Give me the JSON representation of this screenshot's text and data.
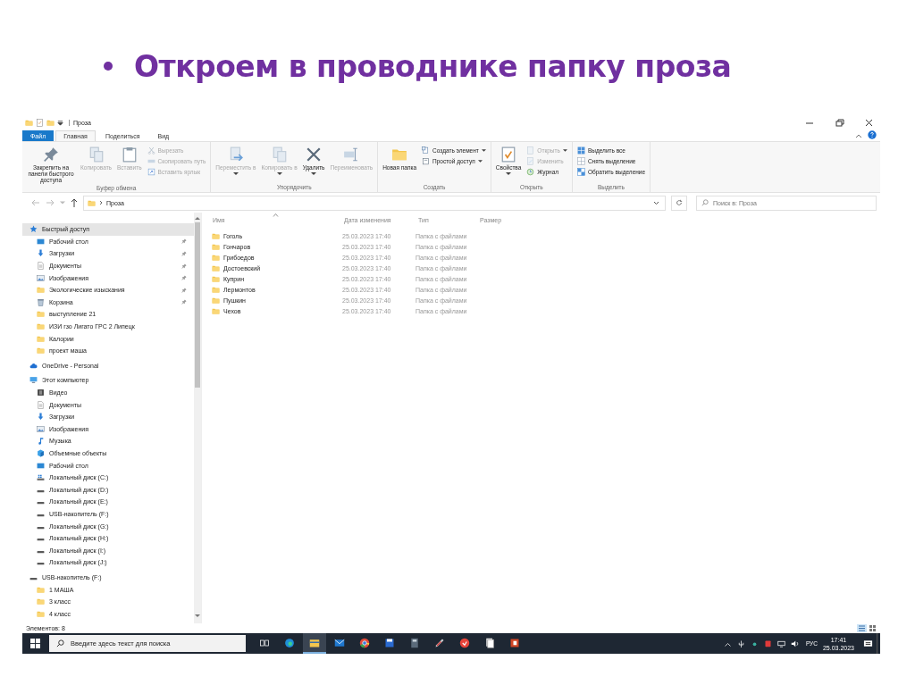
{
  "slide_title": "Откроем в проводнике папку проза",
  "window": {
    "title": "Проза"
  },
  "tabs": [
    {
      "label": "Файл",
      "kind": "file",
      "selected": false
    },
    {
      "label": "Главная",
      "kind": "tab",
      "selected": true
    },
    {
      "label": "Поделиться",
      "kind": "tab",
      "selected": false
    },
    {
      "label": "Вид",
      "kind": "tab",
      "selected": false
    }
  ],
  "ribbon": {
    "groups": [
      {
        "label": "Буфер обмена",
        "commands": [
          {
            "label": "Закрепить на панели быстрого доступа",
            "kind": "large",
            "disabled": false
          },
          {
            "label": "Копировать",
            "kind": "large",
            "disabled": true
          },
          {
            "label": "Вставить",
            "kind": "large",
            "disabled": true
          },
          {
            "label": "Вырезать",
            "kind": "small",
            "disabled": true
          },
          {
            "label": "Скопировать путь",
            "kind": "small",
            "disabled": true
          },
          {
            "label": "Вставить ярлык",
            "kind": "small",
            "disabled": true
          }
        ]
      },
      {
        "label": "Упорядочить",
        "commands": [
          {
            "label": "Переместить в",
            "kind": "large",
            "disabled": true,
            "dropdown": true
          },
          {
            "label": "Копировать в",
            "kind": "large",
            "disabled": true,
            "dropdown": true
          },
          {
            "label": "Удалить",
            "kind": "large",
            "disabled": false,
            "dropdown": true
          },
          {
            "label": "Переименовать",
            "kind": "large",
            "disabled": true
          }
        ]
      },
      {
        "label": "Создать",
        "commands": [
          {
            "label": "Новая папка",
            "kind": "large",
            "disabled": false
          },
          {
            "label": "Создать элемент",
            "kind": "small",
            "disabled": false,
            "dropdown": true
          },
          {
            "label": "Простой доступ",
            "kind": "small",
            "disabled": false,
            "dropdown": true
          }
        ]
      },
      {
        "label": "Открыть",
        "commands": [
          {
            "label": "Свойства",
            "kind": "large",
            "disabled": false,
            "dropdown": true
          },
          {
            "label": "Открыть",
            "kind": "small",
            "disabled": true,
            "dropdown": true
          },
          {
            "label": "Изменить",
            "kind": "small",
            "disabled": true
          },
          {
            "label": "Журнал",
            "kind": "small",
            "disabled": false
          }
        ]
      },
      {
        "label": "Выделить",
        "commands": [
          {
            "label": "Выделить все",
            "kind": "small",
            "disabled": false
          },
          {
            "label": "Снять выделение",
            "kind": "small",
            "disabled": false
          },
          {
            "label": "Обратить выделение",
            "kind": "small",
            "disabled": false
          }
        ]
      }
    ]
  },
  "address": {
    "path": "Проза",
    "search_placeholder": "Поиск в: Проза"
  },
  "sidebar": {
    "items": [
      {
        "label": "Быстрый доступ",
        "kind": "star",
        "selected": true,
        "children": [
          {
            "label": "Рабочий стол",
            "kind": "desktop",
            "selected": false,
            "pinned": true
          },
          {
            "label": "Загрузки",
            "kind": "download",
            "selected": false,
            "pinned": true
          },
          {
            "label": "Документы",
            "kind": "documents",
            "selected": false,
            "pinned": true
          },
          {
            "label": "Изображения",
            "kind": "pictures",
            "selected": false,
            "pinned": true
          },
          {
            "label": "Экологические изыскания",
            "kind": "folder",
            "selected": false,
            "pinned": true
          },
          {
            "label": "Корзина",
            "kind": "recycle",
            "selected": false,
            "pinned": true
          },
          {
            "label": "выступление 21",
            "kind": "folder",
            "selected": false,
            "pinned": false
          },
          {
            "label": "ИЗИ гзо Лигато ГРС 2 Липецк",
            "kind": "folder",
            "selected": false,
            "pinned": false
          },
          {
            "label": "Калории",
            "kind": "folder",
            "selected": false,
            "pinned": false
          },
          {
            "label": "проект маша",
            "kind": "folder",
            "selected": false,
            "pinned": false
          }
        ]
      },
      {
        "label": "OneDrive - Personal",
        "kind": "cloud",
        "selected": false
      },
      {
        "label": "Этот компьютер",
        "kind": "computer",
        "selected": false,
        "children": [
          {
            "label": "Видео",
            "kind": "video",
            "selected": false
          },
          {
            "label": "Документы",
            "kind": "documents",
            "selected": false
          },
          {
            "label": "Загрузки",
            "kind": "download",
            "selected": false
          },
          {
            "label": "Изображения",
            "kind": "pictures",
            "selected": false
          },
          {
            "label": "Музыка",
            "kind": "music",
            "selected": false
          },
          {
            "label": "Объемные объекты",
            "kind": "objects",
            "selected": false
          },
          {
            "label": "Рабочий стол",
            "kind": "desktop",
            "selected": false
          },
          {
            "label": "Локальный диск (C:)",
            "kind": "system-drive",
            "selected": false
          },
          {
            "label": "Локальный диск (D:)",
            "kind": "drive",
            "selected": false
          },
          {
            "label": "Локальный диск (E:)",
            "kind": "drive",
            "selected": false
          },
          {
            "label": "USB-накопитель (F:)",
            "kind": "drive",
            "selected": false
          },
          {
            "label": "Локальный диск (G:)",
            "kind": "drive",
            "selected": false
          },
          {
            "label": "Локальный диск (H:)",
            "kind": "drive",
            "selected": false
          },
          {
            "label": "Локальный диск (I:)",
            "kind": "drive",
            "selected": false
          },
          {
            "label": "Локальный диск (J:)",
            "kind": "drive",
            "selected": false
          }
        ]
      },
      {
        "label": "USB-накопитель (F:)",
        "kind": "drive",
        "selected": false,
        "children": [
          {
            "label": "1 МАША",
            "kind": "folder",
            "selected": false
          },
          {
            "label": "3 класс",
            "kind": "folder",
            "selected": false
          },
          {
            "label": "4 класс",
            "kind": "folder",
            "selected": false
          }
        ]
      }
    ]
  },
  "table": {
    "columns": [
      {
        "label": "Имя",
        "sorted": true
      },
      {
        "label": "Дата изменения",
        "sorted": false
      },
      {
        "label": "Тип",
        "sorted": false
      },
      {
        "label": "Размер",
        "sorted": false
      }
    ],
    "rows": [
      {
        "name": "Гоголь",
        "date": "25.03.2023 17:40",
        "type": "Папка с файлами"
      },
      {
        "name": "Гончаров",
        "date": "25.03.2023 17:40",
        "type": "Папка с файлами"
      },
      {
        "name": "Грибоедов",
        "date": "25.03.2023 17:40",
        "type": "Папка с файлами"
      },
      {
        "name": "Достоевский",
        "date": "25.03.2023 17:40",
        "type": "Папка с файлами"
      },
      {
        "name": "Куприн",
        "date": "25.03.2023 17:40",
        "type": "Папка с файлами"
      },
      {
        "name": "Лермонтов",
        "date": "25.03.2023 17:40",
        "type": "Папка с файлами"
      },
      {
        "name": "Пушкин",
        "date": "25.03.2023 17:40",
        "type": "Папка с файлами"
      },
      {
        "name": "Чехов",
        "date": "25.03.2023 17:40",
        "type": "Папка с файлами"
      }
    ]
  },
  "status_bar": {
    "text": "Элементов: 8"
  },
  "taskbar": {
    "search_placeholder": "Введите здесь текст для поиска",
    "apps": [
      {
        "kind": "task-view",
        "active": false
      },
      {
        "kind": "browser",
        "active": false
      },
      {
        "kind": "explorer",
        "active": true
      },
      {
        "kind": "mail",
        "active": false
      },
      {
        "kind": "chrome",
        "active": false
      },
      {
        "kind": "floppy",
        "active": false
      },
      {
        "kind": "calculator",
        "active": false
      },
      {
        "kind": "pen",
        "active": false
      },
      {
        "kind": "round-app",
        "active": false
      },
      {
        "kind": "document",
        "active": false
      },
      {
        "kind": "slides",
        "active": false
      }
    ],
    "language": "РУС",
    "time": "17:41",
    "date": "25.03.2023"
  }
}
